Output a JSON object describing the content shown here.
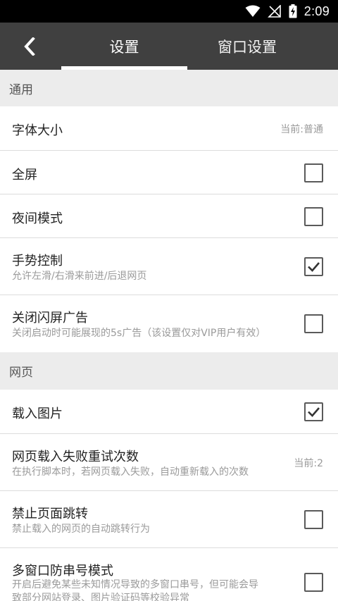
{
  "status_bar": {
    "time": "2:09"
  },
  "header": {
    "tabs": [
      {
        "label": "设置",
        "selected": true
      },
      {
        "label": "窗口设置",
        "selected": false
      }
    ]
  },
  "sections": {
    "general": "通用",
    "webpage": "网页"
  },
  "settings": {
    "font_size": {
      "title": "字体大小",
      "value": "当前:普通"
    },
    "fullscreen": {
      "title": "全屏",
      "checked": false
    },
    "night_mode": {
      "title": "夜间模式",
      "checked": false
    },
    "gesture": {
      "title": "手势控制",
      "subtitle": "允许左滑/右滑来前进/后退网页",
      "checked": true
    },
    "splash_ad": {
      "title": "关闭闪屏广告",
      "subtitle": "关闭启动时可能展现的5s广告（该设置仅对VIP用户有效）",
      "checked": false
    },
    "load_images": {
      "title": "载入图片",
      "checked": true
    },
    "retry": {
      "title": "网页载入失败重试次数",
      "subtitle": "在执行脚本时，若网页载入失败，自动重新载入的次数",
      "value": "当前:2"
    },
    "no_redirect": {
      "title": "禁止页面跳转",
      "subtitle": "禁止载入的网页的自动跳转行为",
      "checked": false
    },
    "multi_window": {
      "title": "多窗口防串号模式",
      "subtitle_line1": "开启后避免某些未知情况导致的多窗口串号，但可能会导",
      "subtitle_line2": "致部分网站登录、图片验证码等校验异常",
      "checked": false
    }
  },
  "colors": {
    "toolbar": "#404040",
    "section_bg": "#ececec",
    "status_bar": "#000000"
  }
}
